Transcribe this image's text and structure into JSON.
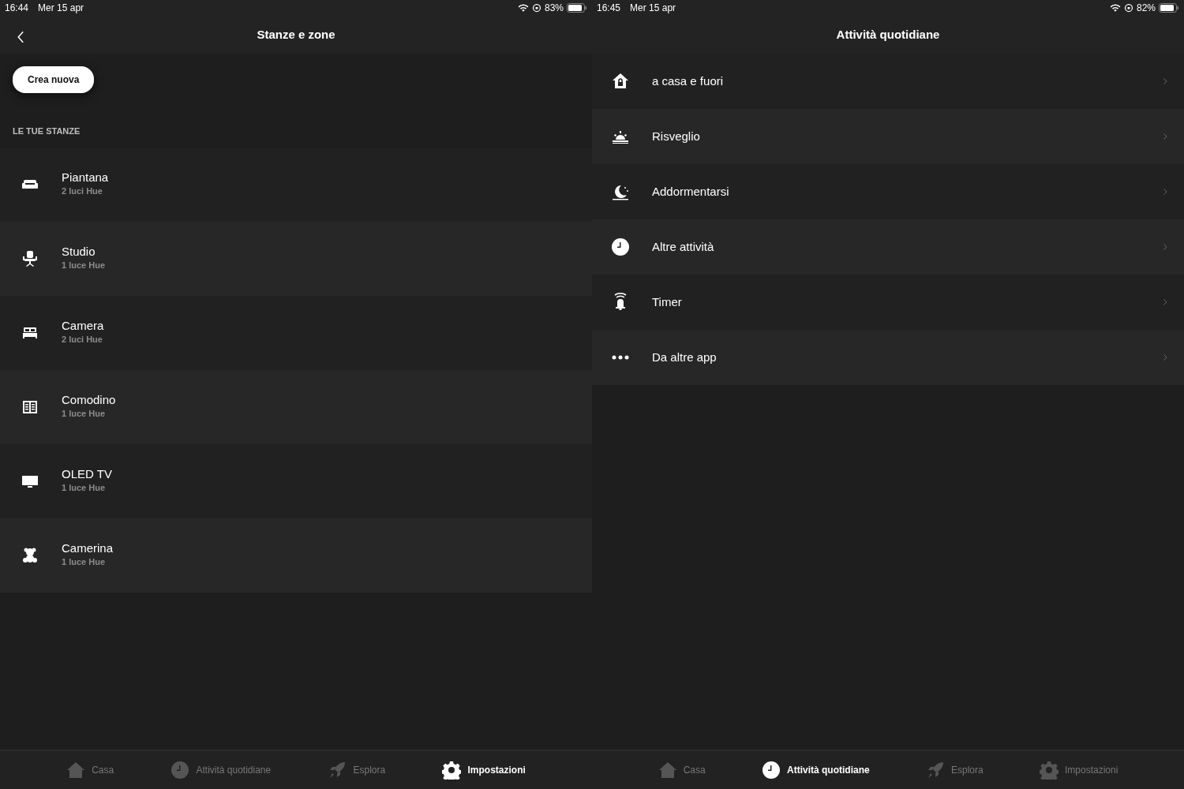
{
  "screens": [
    {
      "status_bar": {
        "time": "16:44",
        "date": "Mer 15 apr",
        "battery": "83%"
      },
      "header": {
        "title": "Stanze e zone",
        "back": true
      },
      "create_button": {
        "label": "Crea nuova"
      },
      "section_label": "LE TUE STANZE",
      "rooms": [
        {
          "name": "Piantana",
          "subtitle": "2 luci Hue"
        },
        {
          "name": "Studio",
          "subtitle": "1 luce Hue"
        },
        {
          "name": "Camera",
          "subtitle": "2 luci Hue"
        },
        {
          "name": "Comodino",
          "subtitle": "1 luce Hue"
        },
        {
          "name": "OLED TV",
          "subtitle": "1 luce Hue"
        },
        {
          "name": "Camerina",
          "subtitle": "1 luce Hue"
        }
      ],
      "tabs": [
        {
          "label": "Casa",
          "selected": false
        },
        {
          "label": "Attività quotidiane",
          "selected": false
        },
        {
          "label": "Esplora",
          "selected": false
        },
        {
          "label": "Impostazioni",
          "selected": true
        }
      ]
    },
    {
      "status_bar": {
        "time": "16:45",
        "date": "Mer 15 apr",
        "battery": "82%"
      },
      "header": {
        "title": "Attività quotidiane",
        "back": false
      },
      "activities": [
        {
          "label": "a casa e fuori"
        },
        {
          "label": "Risveglio"
        },
        {
          "label": "Addormentarsi"
        },
        {
          "label": "Altre attività"
        },
        {
          "label": "Timer"
        },
        {
          "label": "Da altre app"
        }
      ],
      "tabs": [
        {
          "label": "Casa",
          "selected": false
        },
        {
          "label": "Attività quotidiane",
          "selected": true
        },
        {
          "label": "Esplora",
          "selected": false
        },
        {
          "label": "Impostazioni",
          "selected": false
        }
      ]
    }
  ]
}
